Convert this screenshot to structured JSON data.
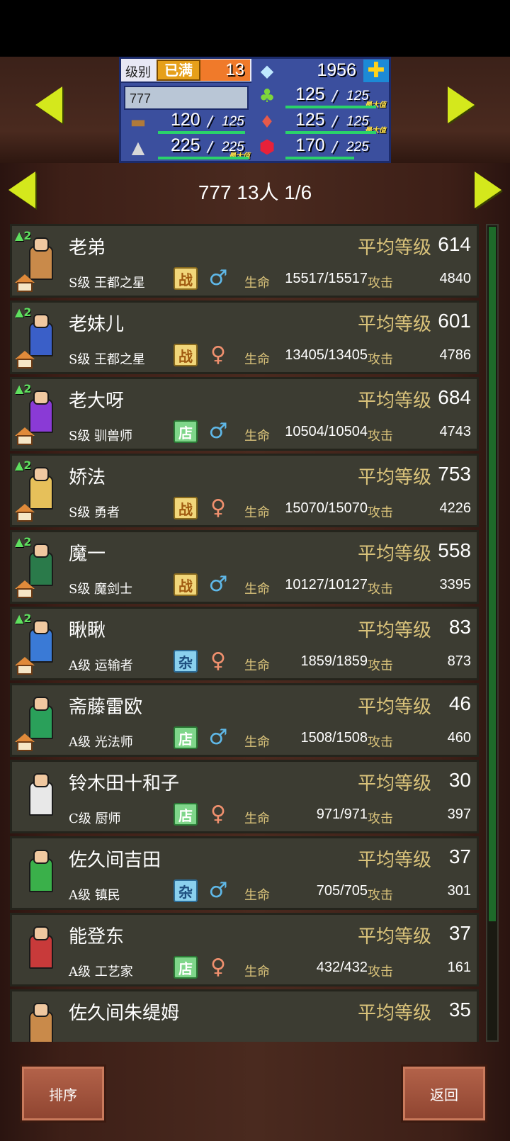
{
  "header": {
    "level_label": "级别",
    "level_badge": "已满",
    "level_value": "13",
    "gems": "1956",
    "plus_icon": "plus-icon",
    "town_name": "777",
    "max_tag": "最大值",
    "resources": [
      {
        "icon": "grass-icon",
        "current": "125",
        "max": "125",
        "is_max": true,
        "fill": 1.0
      },
      {
        "icon": "wood-icon",
        "current": "120",
        "max": "125",
        "is_max": false,
        "fill": 0.96
      },
      {
        "icon": "meat-icon",
        "current": "125",
        "max": "125",
        "is_max": true,
        "fill": 1.0
      },
      {
        "icon": "ore-icon",
        "current": "225",
        "max": "225",
        "is_max": true,
        "fill": 1.0
      },
      {
        "icon": "ruby-icon",
        "current": "170",
        "max": "225",
        "is_max": false,
        "fill": 0.76
      }
    ]
  },
  "title": "777  13人 1/6",
  "columns": {
    "avg_level_label": "平均等级",
    "hp_label": "生命",
    "atk_label": "攻击"
  },
  "characters": [
    {
      "name": "老弟",
      "avg_level": "614",
      "rank_job": "S级 王都之星",
      "type": "战",
      "type_class": "badge-zhan",
      "gender": "male",
      "hp": "15517/15517",
      "atk": "4840",
      "level_tag": "2"
    },
    {
      "name": "老妹儿",
      "avg_level": "601",
      "rank_job": "S级 王都之星",
      "type": "战",
      "type_class": "badge-zhan",
      "gender": "female",
      "hp": "13405/13405",
      "atk": "4786",
      "level_tag": "2"
    },
    {
      "name": "老大呀",
      "avg_level": "684",
      "rank_job": "S级 驯兽师",
      "type": "店",
      "type_class": "badge-dian",
      "gender": "male",
      "hp": "10504/10504",
      "atk": "4743",
      "level_tag": "2"
    },
    {
      "name": "娇法",
      "avg_level": "753",
      "rank_job": "S级 勇者",
      "type": "战",
      "type_class": "badge-zhan",
      "gender": "female",
      "hp": "15070/15070",
      "atk": "4226",
      "level_tag": "2"
    },
    {
      "name": "魔一",
      "avg_level": "558",
      "rank_job": "S级 魔剑士",
      "type": "战",
      "type_class": "badge-zhan",
      "gender": "male",
      "hp": "10127/10127",
      "atk": "3395",
      "level_tag": "2"
    },
    {
      "name": "瞅瞅",
      "avg_level": "83",
      "rank_job": "A级 运输者",
      "type": "杂",
      "type_class": "badge-za",
      "gender": "female",
      "hp": "1859/1859",
      "atk": "873",
      "level_tag": "2"
    },
    {
      "name": "斋藤雷欧",
      "avg_level": "46",
      "rank_job": "A级 光法师",
      "type": "店",
      "type_class": "badge-dian",
      "gender": "male",
      "hp": "1508/1508",
      "atk": "460",
      "level_tag": ""
    },
    {
      "name": "铃木田十和子",
      "avg_level": "30",
      "rank_job": "C级 厨师",
      "type": "店",
      "type_class": "badge-dian",
      "gender": "female",
      "hp": "971/971",
      "atk": "397",
      "level_tag": ""
    },
    {
      "name": "佐久间吉田",
      "avg_level": "37",
      "rank_job": "A级 镇民",
      "type": "杂",
      "type_class": "badge-za",
      "gender": "male",
      "hp": "705/705",
      "atk": "301",
      "level_tag": ""
    },
    {
      "name": "能登东",
      "avg_level": "37",
      "rank_job": "A级 工艺家",
      "type": "店",
      "type_class": "badge-dian",
      "gender": "female",
      "hp": "432/432",
      "atk": "161",
      "level_tag": ""
    },
    {
      "name": "佐久间朱缇姆",
      "avg_level": "35",
      "rank_job": "",
      "type": "",
      "type_class": "",
      "gender": "",
      "hp": "",
      "atk": "",
      "level_tag": ""
    }
  ],
  "buttons": {
    "sort": "排序",
    "back": "返回"
  },
  "colors": {
    "card_bg": "#3c3c32",
    "gold_label": "#d9c27a",
    "arrow": "#d4e81c",
    "panel": "#3b4f9e"
  }
}
